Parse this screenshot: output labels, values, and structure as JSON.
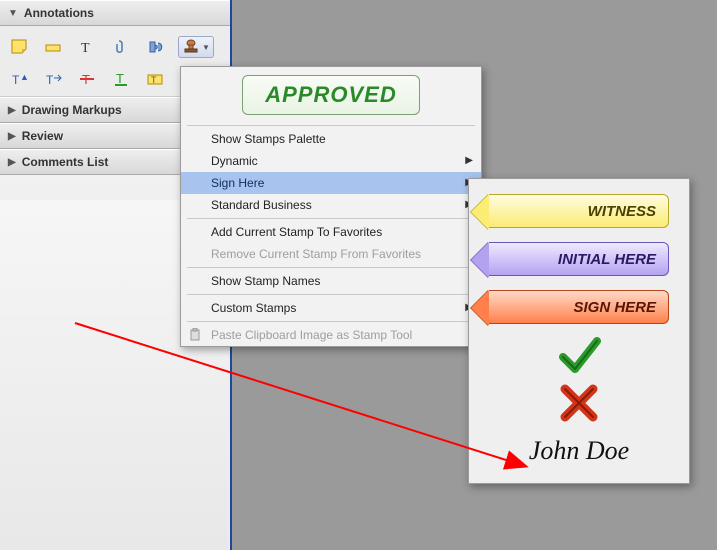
{
  "sidebar": {
    "sections": {
      "annotations": "Annotations",
      "drawing_markups": "Drawing Markups",
      "review": "Review",
      "comments_list": "Comments List"
    },
    "tools_row1": [
      {
        "name": "sticky-note-icon"
      },
      {
        "name": "highlight-icon"
      },
      {
        "name": "text-edit-icon"
      },
      {
        "name": "attach-file-icon"
      },
      {
        "name": "sound-icon"
      },
      {
        "name": "stamp-icon"
      }
    ],
    "tools_row2": [
      {
        "name": "insert-text-icon"
      },
      {
        "name": "replace-text-icon"
      },
      {
        "name": "strikethrough-icon"
      },
      {
        "name": "underline-icon"
      },
      {
        "name": "add-note-icon"
      }
    ]
  },
  "stamp_menu": {
    "preview_label": "APPROVED",
    "items": {
      "show_palette": "Show Stamps Palette",
      "dynamic": "Dynamic",
      "sign_here": "Sign Here",
      "standard_business": "Standard Business",
      "add_favorite": "Add Current Stamp To Favorites",
      "remove_favorite": "Remove Current Stamp From Favorites",
      "show_names": "Show Stamp Names",
      "custom_stamps": "Custom Stamps",
      "paste_clipboard": "Paste Clipboard Image as Stamp Tool"
    }
  },
  "sign_here_submenu": {
    "witness": "WITNESS",
    "initial_here": "INITIAL HERE",
    "sign_here": "SIGN HERE",
    "signature_sample": "John Doe"
  }
}
